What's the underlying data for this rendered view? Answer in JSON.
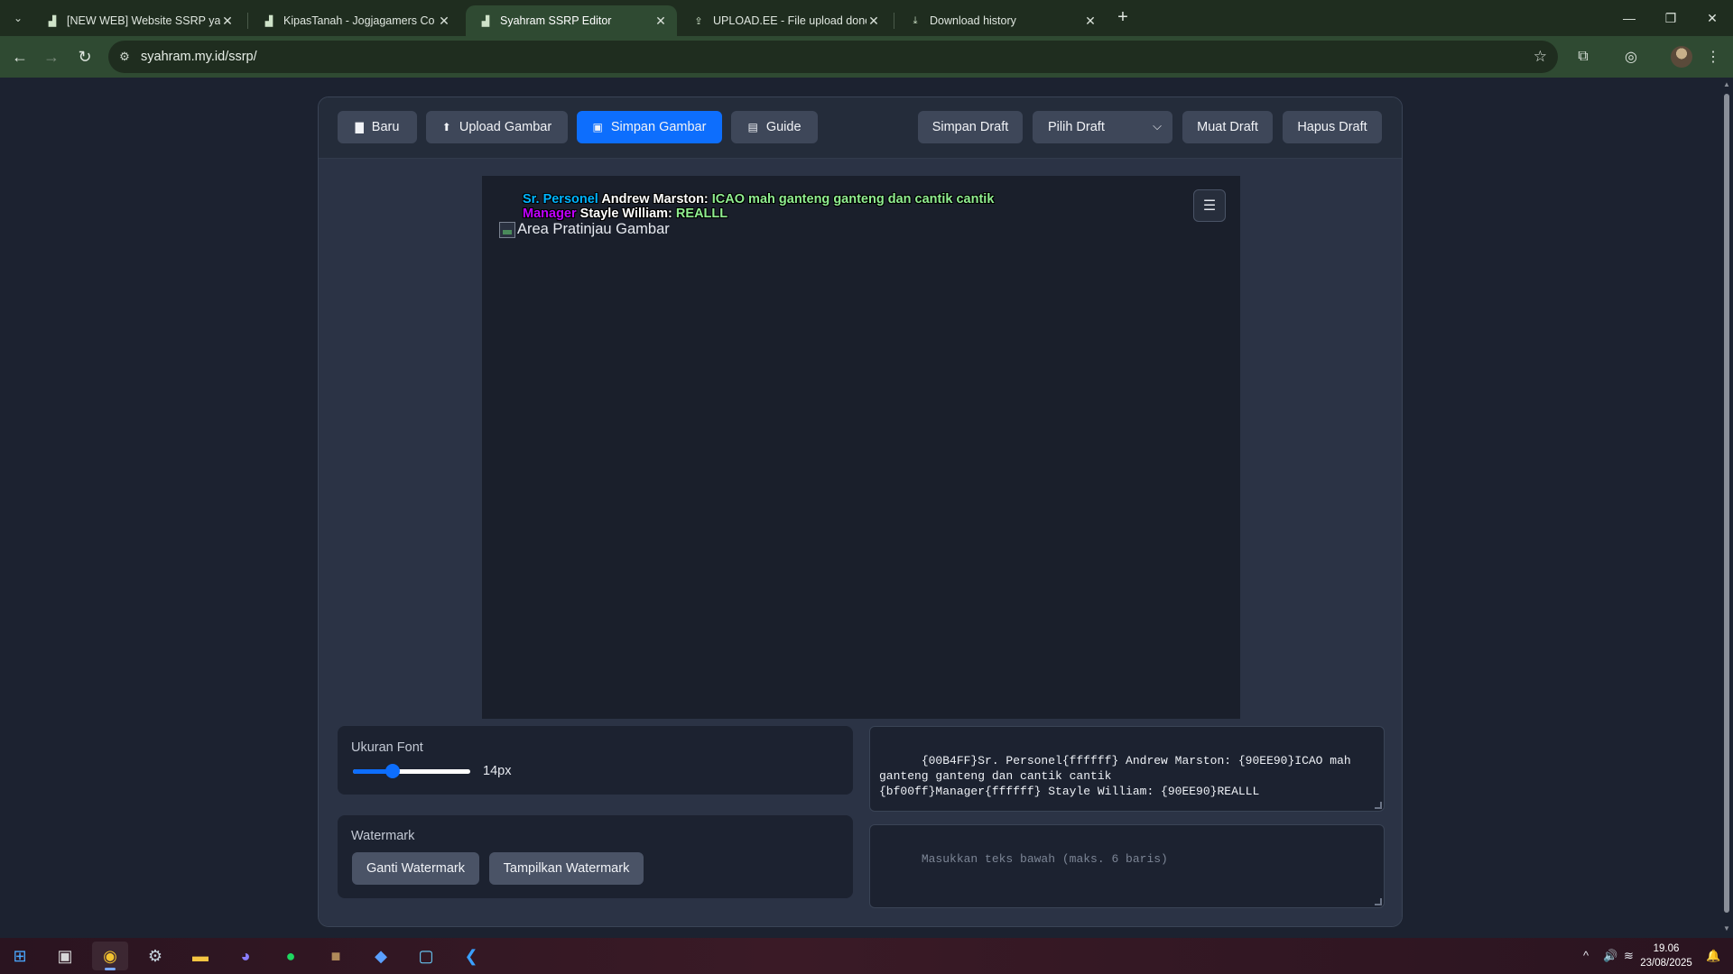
{
  "browser": {
    "tabs": [
      {
        "title": "[NEW WEB] Website SSRP yang",
        "icon": "ssrp-favicon"
      },
      {
        "title": "KipasTanah - Jogjagamers Co",
        "icon": "ssrp-favicon"
      },
      {
        "title": "Syahram SSRP Editor",
        "icon": "ssrp-favicon"
      },
      {
        "title": "UPLOAD.EE - File upload done",
        "icon": "upload-favicon"
      },
      {
        "title": "Download history",
        "icon": "download-icon"
      }
    ],
    "active_tab_index": 2,
    "url": "syahram.my.id/ssrp/"
  },
  "toolbar": {
    "baru": "Baru",
    "upload": "Upload Gambar",
    "simpan_gambar": "Simpan Gambar",
    "guide": "Guide",
    "simpan_draft": "Simpan Draft",
    "pilih_draft": "Pilih Draft",
    "muat_draft": "Muat Draft",
    "hapus_draft": "Hapus Draft"
  },
  "preview": {
    "line1": {
      "rank": "Sr. Personel",
      "name": "Andrew Marston:",
      "message": "ICAO mah ganteng ganteng dan cantik cantik"
    },
    "line2": {
      "rank": "Manager",
      "name": "Stayle William:",
      "message": "REALLL"
    },
    "image_alt": "Area Pratinjau Gambar",
    "colors": {
      "rank1": "#00B4FF",
      "rank2": "#bf00ff",
      "name": "#ffffff",
      "message": "#90EE90"
    }
  },
  "font_panel": {
    "label": "Ukuran Font",
    "value": "14px",
    "slider_fraction": 0.32
  },
  "watermark_panel": {
    "label": "Watermark",
    "ganti": "Ganti Watermark",
    "tampilkan": "Tampilkan Watermark"
  },
  "chat_input": {
    "value": "{00B4FF}Sr. Personel{ffffff} Andrew Marston: {90EE90}ICAO mah ganteng ganteng dan cantik cantik\n{bf00ff}Manager{ffffff} Stayle William: {90EE90}REALLL"
  },
  "bottom_input": {
    "placeholder": "Masukkan teks bawah (maks. 6 baris)"
  },
  "taskbar": {
    "time": "19.06",
    "date": "23/08/2025"
  },
  "accent_color": "#0d6efd"
}
